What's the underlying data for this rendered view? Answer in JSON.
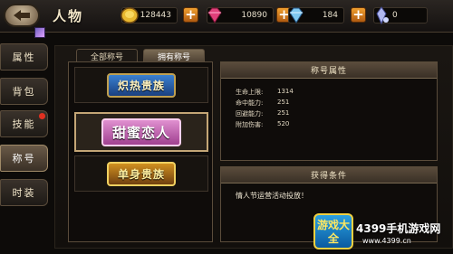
{
  "header": {
    "title": "人物",
    "resources": [
      {
        "name": "gold",
        "value": "128443",
        "icon": "gold-coin-icon"
      },
      {
        "name": "gem",
        "value": "10890",
        "icon": "pink-diamond-icon"
      },
      {
        "name": "bound_gem",
        "value": "184",
        "icon": "blue-diamond-icon"
      },
      {
        "name": "crystal",
        "value": "0",
        "icon": "crystal-icon"
      }
    ]
  },
  "sidebar": {
    "items": [
      {
        "label": "属性",
        "active": false
      },
      {
        "label": "背包",
        "active": false
      },
      {
        "label": "技能",
        "active": false,
        "has_dot": true
      },
      {
        "label": "称号",
        "active": true
      },
      {
        "label": "时装",
        "active": false
      }
    ]
  },
  "tabs": [
    {
      "label": "全部称号",
      "active": false
    },
    {
      "label": "拥有称号",
      "active": true
    }
  ],
  "titles": [
    {
      "label": "炽热贵族",
      "style": "blue"
    },
    {
      "label": "甜蜜恋人",
      "style": "pink",
      "selected": true
    },
    {
      "label": "单身贵族",
      "style": "gold"
    }
  ],
  "attributes": {
    "heading": "称号属性",
    "stats": [
      {
        "label": "生命上限:",
        "value": "1314"
      },
      {
        "label": "命中能力:",
        "value": "251"
      },
      {
        "label": "回避能力:",
        "value": "251"
      },
      {
        "label": "附加伤害:",
        "value": "520"
      }
    ]
  },
  "conditions": {
    "heading": "获得条件",
    "text": "情人节运营活动投放！"
  },
  "watermark": {
    "logo": "游戏大全",
    "site": "4399手机游戏网",
    "url": "www.4399.cn"
  },
  "colors": {
    "accent_orange": "#f0a030",
    "panel_border": "#5a4c3b",
    "background": "#0d0b09"
  }
}
